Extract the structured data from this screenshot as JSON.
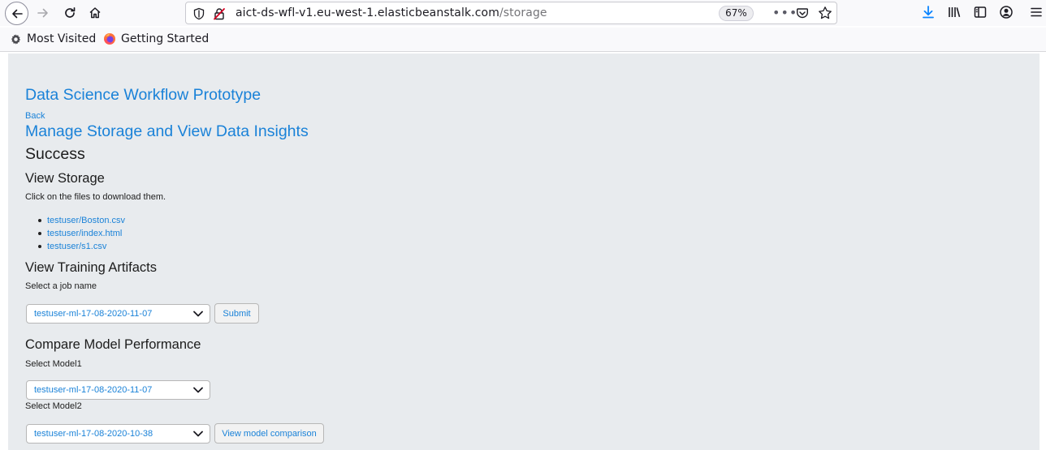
{
  "browser": {
    "url_host": "aict-ds-wfl-v1.eu-west-1.elasticbeanstalk.com",
    "url_path": "/storage",
    "zoom": "67%",
    "more_label": "•••",
    "bookmarks": [
      {
        "label": "Most Visited",
        "icon": "gear-icon"
      },
      {
        "label": "Getting Started",
        "icon": "firefox-icon"
      }
    ]
  },
  "page": {
    "app_title": "Data Science Workflow Prototype",
    "back_label": "Back",
    "heading": "Manage Storage and View Data Insights",
    "status": "Success",
    "storage": {
      "heading": "View Storage",
      "hint": "Click on the files to download them.",
      "files": [
        "testuser/Boston.csv",
        "testuser/index.html",
        "testuser/s1.csv"
      ]
    },
    "training": {
      "heading": "View Training Artifacts",
      "label": "Select a job name",
      "selected_job": "testuser-ml-17-08-2020-11-07",
      "submit_label": "Submit"
    },
    "compare": {
      "heading": "Compare Model Performance",
      "model1_label": "Select Model1",
      "model1_value": "testuser-ml-17-08-2020-11-07",
      "model2_label": "Select Model2",
      "model2_value": "testuser-ml-17-08-2020-10-38",
      "compare_label": "View model comparison"
    }
  },
  "colors": {
    "link": "#1a82d8",
    "page_background": "#e8ebee",
    "chrome_background": "#f9f9fb"
  }
}
